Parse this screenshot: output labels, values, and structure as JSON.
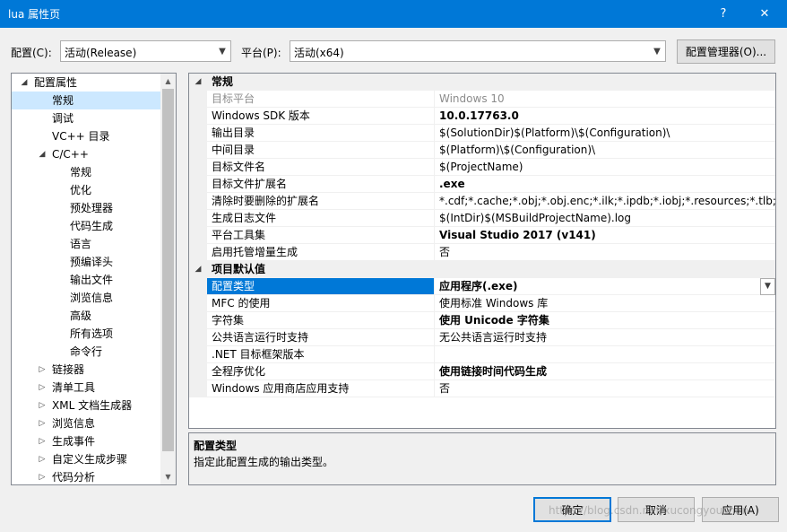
{
  "window": {
    "title": "lua 属性页",
    "help_label": "?",
    "close_label": "✕"
  },
  "config": {
    "config_label": "配置(C):",
    "config_value": "活动(Release)",
    "platform_label": "平台(P):",
    "platform_value": "活动(x64)",
    "manager_button": "配置管理器(O)..."
  },
  "tree": {
    "items": [
      {
        "label": "配置属性",
        "expander": "◢"
      },
      {
        "label": "常规",
        "expander": ""
      },
      {
        "label": "调试",
        "expander": ""
      },
      {
        "label": "VC++ 目录",
        "expander": ""
      },
      {
        "label": "C/C++",
        "expander": "◢"
      },
      {
        "label": "常规",
        "expander": ""
      },
      {
        "label": "优化",
        "expander": ""
      },
      {
        "label": "预处理器",
        "expander": ""
      },
      {
        "label": "代码生成",
        "expander": ""
      },
      {
        "label": "语言",
        "expander": ""
      },
      {
        "label": "预编译头",
        "expander": ""
      },
      {
        "label": "输出文件",
        "expander": ""
      },
      {
        "label": "浏览信息",
        "expander": ""
      },
      {
        "label": "高级",
        "expander": ""
      },
      {
        "label": "所有选项",
        "expander": ""
      },
      {
        "label": "命令行",
        "expander": ""
      },
      {
        "label": "链接器",
        "expander": "▷"
      },
      {
        "label": "清单工具",
        "expander": "▷"
      },
      {
        "label": "XML 文档生成器",
        "expander": "▷"
      },
      {
        "label": "浏览信息",
        "expander": "▷"
      },
      {
        "label": "生成事件",
        "expander": "▷"
      },
      {
        "label": "自定义生成步骤",
        "expander": "▷"
      },
      {
        "label": "代码分析",
        "expander": "▷"
      }
    ]
  },
  "grid": {
    "categories": {
      "general": {
        "label": "常规",
        "expander": "◢"
      },
      "defaults": {
        "label": "项目默认值",
        "expander": "◢"
      }
    },
    "general_rows": [
      {
        "name": "目标平台",
        "value": "Windows 10"
      },
      {
        "name": "Windows SDK 版本",
        "value": "10.0.17763.0"
      },
      {
        "name": "输出目录",
        "value": "$(SolutionDir)$(Platform)\\$(Configuration)\\"
      },
      {
        "name": "中间目录",
        "value": "$(Platform)\\$(Configuration)\\"
      },
      {
        "name": "目标文件名",
        "value": "$(ProjectName)"
      },
      {
        "name": "目标文件扩展名",
        "value": ".exe"
      },
      {
        "name": "清除时要删除的扩展名",
        "value": "*.cdf;*.cache;*.obj;*.obj.enc;*.ilk;*.ipdb;*.iobj;*.resources;*.tlb;*.tli;*.t"
      },
      {
        "name": "生成日志文件",
        "value": "$(IntDir)$(MSBuildProjectName).log"
      },
      {
        "name": "平台工具集",
        "value": "Visual Studio 2017 (v141)"
      },
      {
        "name": "启用托管增量生成",
        "value": "否"
      }
    ],
    "default_rows": [
      {
        "name": "配置类型",
        "value": "应用程序(.exe)"
      },
      {
        "name": "MFC 的使用",
        "value": "使用标准 Windows 库"
      },
      {
        "name": "字符集",
        "value": "使用 Unicode 字符集"
      },
      {
        "name": "公共语言运行时支持",
        "value": "无公共语言运行时支持"
      },
      {
        "name": ".NET 目标框架版本",
        "value": ""
      },
      {
        "name": "全程序优化",
        "value": "使用链接时间代码生成"
      },
      {
        "name": "Windows 应用商店应用支持",
        "value": "否"
      }
    ]
  },
  "description": {
    "title": "配置类型",
    "text": "指定此配置生成的输出类型。"
  },
  "buttons": {
    "ok": "确定",
    "cancel": "取消",
    "apply": "应用(A)"
  },
  "watermark": "https://blog.csdn.net/xucongyoushan"
}
